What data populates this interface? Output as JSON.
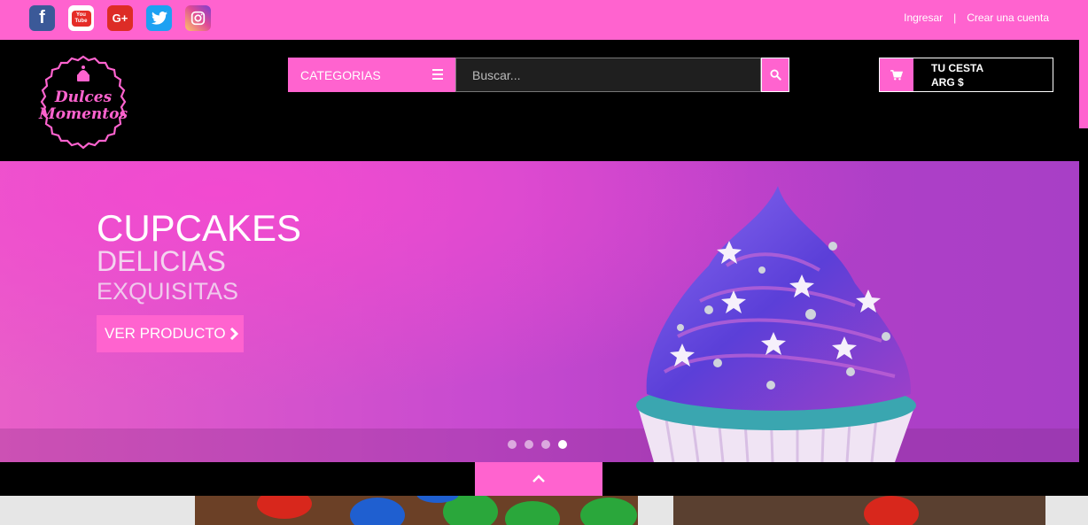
{
  "topbar": {
    "social": [
      {
        "name": "facebook-icon",
        "glyph": "f"
      },
      {
        "name": "youtube-icon",
        "glyph_top": "You",
        "glyph_bottom": "Tube"
      },
      {
        "name": "google-plus-icon",
        "glyph": "G+"
      },
      {
        "name": "twitter-icon"
      },
      {
        "name": "instagram-icon"
      }
    ],
    "login_label": "Ingresar",
    "separator": "|",
    "register_label": "Crear una cuenta"
  },
  "header": {
    "logo": {
      "line1": "Dulces",
      "line2": "Momentos"
    },
    "categories_label": "CATEGORIAS",
    "search_placeholder": "Buscar...",
    "cart": {
      "title": "TU CESTA",
      "amount": "ARG $"
    }
  },
  "hero": {
    "title": "CUPCAKES",
    "subtitle1": "DELICIAS",
    "subtitle2": "EXQUISITAS",
    "button_label": "VER PRODUCTO",
    "slide_count": 4,
    "active_slide": 4
  },
  "colors": {
    "accent": "#ff63cf",
    "header_bg": "#000000",
    "hero_pink": "#e85fc8",
    "hero_purple": "#a83fc6"
  }
}
